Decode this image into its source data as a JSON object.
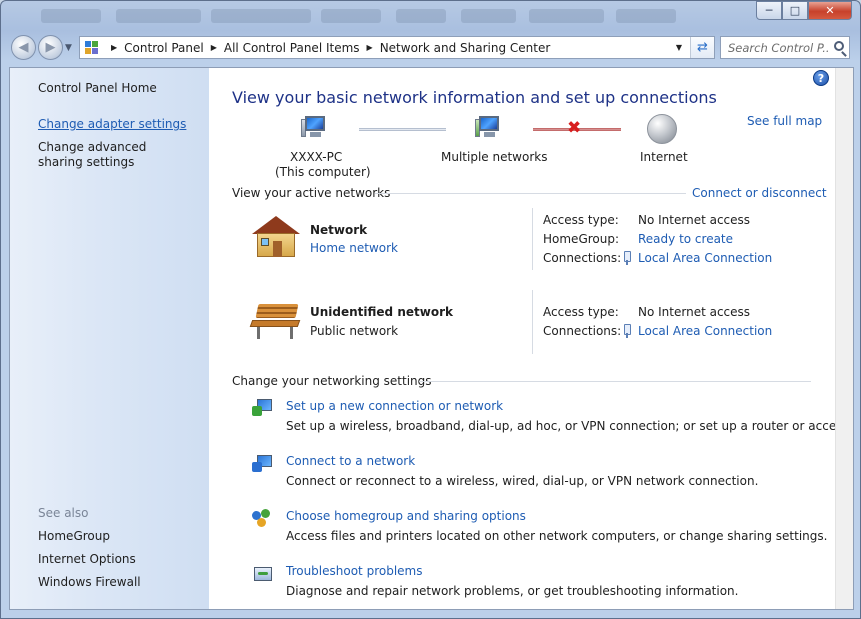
{
  "navigation": {
    "breadcrumbs": [
      "Control Panel",
      "All Control Panel Items",
      "Network and Sharing Center"
    ],
    "search_placeholder": "Search Control P..."
  },
  "sidebar": {
    "home": "Control Panel Home",
    "links": [
      "Change adapter settings",
      "Change advanced sharing settings"
    ],
    "see_also_label": "See also",
    "see_also": [
      "HomeGroup",
      "Internet Options",
      "Windows Firewall"
    ]
  },
  "main": {
    "title": "View your basic network information and set up connections",
    "see_full_map": "See full map",
    "map": {
      "computer_name": "XXXX-PC",
      "computer_sub": "(This computer)",
      "middle": "Multiple networks",
      "internet": "Internet"
    },
    "active_networks_heading": "View your active networks",
    "connect_or_disconnect": "Connect or disconnect",
    "networks": [
      {
        "name": "Network",
        "type": "Home network",
        "type_is_link": true,
        "props": [
          {
            "label": "Access type:",
            "value": "No Internet access",
            "is_link": false
          },
          {
            "label": "HomeGroup:",
            "value": "Ready to create",
            "is_link": true
          },
          {
            "label": "Connections:",
            "value": "Local Area Connection",
            "is_link": true
          }
        ]
      },
      {
        "name": "Unidentified network",
        "type": "Public network",
        "type_is_link": false,
        "props": [
          {
            "label": "Access type:",
            "value": "No Internet access",
            "is_link": false
          },
          {
            "label": "Connections:",
            "value": "Local Area Connection",
            "is_link": true
          }
        ]
      }
    ],
    "settings_heading": "Change your networking settings",
    "settings": [
      {
        "title": "Set up a new connection or network",
        "desc": "Set up a wireless, broadband, dial-up, ad hoc, or VPN connection; or set up a router or access point."
      },
      {
        "title": "Connect to a network",
        "desc": "Connect or reconnect to a wireless, wired, dial-up, or VPN network connection."
      },
      {
        "title": "Choose homegroup and sharing options",
        "desc": "Access files and printers located on other network computers, or change sharing settings."
      },
      {
        "title": "Troubleshoot problems",
        "desc": "Diagnose and repair network problems, or get troubleshooting information."
      }
    ]
  }
}
